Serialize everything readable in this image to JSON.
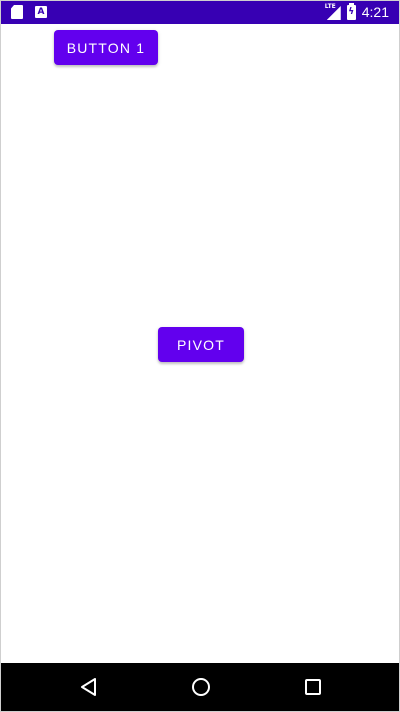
{
  "status_bar": {
    "time": "4:21",
    "network_label": "LTE",
    "left_icons": [
      "sd-card-icon",
      "a-notification-icon"
    ],
    "right_icons": [
      "lte-signal-icon",
      "battery-charging-icon"
    ],
    "a_icon_letter": "A"
  },
  "buttons": {
    "button_1_label": "BUTTON 1",
    "pivot_label": "PIVOT"
  },
  "nav_bar": {
    "icons": [
      "back-icon",
      "home-icon",
      "recents-icon"
    ]
  },
  "colors": {
    "status_bar": "#3700b3",
    "button": "#6200ee",
    "button_text": "#ffffff",
    "background": "#ffffff",
    "nav_bar": "#000000"
  }
}
